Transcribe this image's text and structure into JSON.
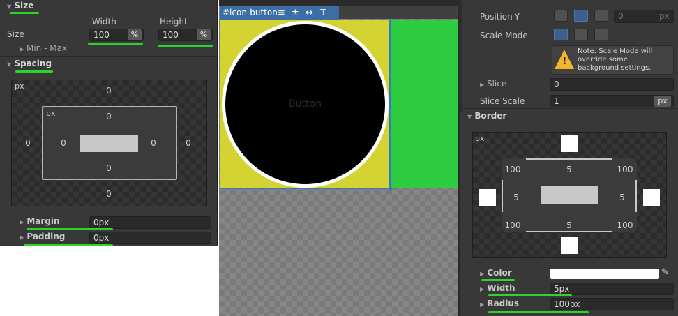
{
  "left_panel": {
    "size_header": "Size",
    "size_label": "Size",
    "width_label": "Width",
    "height_label": "Height",
    "width_value": "100",
    "height_value": "100",
    "width_unit": "%",
    "height_unit": "%",
    "min_max_label": "Min - Max",
    "spacing_header": "Spacing",
    "spacing_box": {
      "outer_unit": "px",
      "inner_unit": "px",
      "margin_top": "0",
      "margin_left": "0",
      "margin_right": "0",
      "margin_bottom": "0",
      "padding_top": "0",
      "padding_left": "0",
      "padding_right": "0",
      "padding_bottom": "0"
    },
    "margin_label": "Margin",
    "margin_value": "0px",
    "padding_label": "Padding",
    "padding_value": "0px"
  },
  "viewport": {
    "element_tag": "#icon-button",
    "button_text": "Button",
    "colors": {
      "yellow": "#d3d334",
      "green": "#2ecc40",
      "circle": "#000000",
      "border": "#ffffff",
      "tag_bg": "#3a6ea5"
    }
  },
  "right_panel": {
    "position_y_label": "Position-Y",
    "position_y_value": "0",
    "position_y_unit": "px",
    "scale_mode_label": "Scale Mode",
    "note_text": "Note: Scale Mode will override some background settings.",
    "slice_label": "Slice",
    "slice_value": "0",
    "slice_scale_label": "Slice Scale",
    "slice_scale_value": "1",
    "slice_scale_unit": "px",
    "border_header": "Border",
    "border_box": {
      "unit": "px",
      "radius_top_left": "100",
      "radius_top_right": "100",
      "radius_bottom_left": "100",
      "radius_bottom_right": "100",
      "width_top": "5",
      "width_left": "5",
      "width_right": "5",
      "width_bottom": "5"
    },
    "color_label": "Color",
    "width_label": "Width",
    "width_value": "5px",
    "radius_label": "Radius",
    "radius_value": "100px"
  }
}
